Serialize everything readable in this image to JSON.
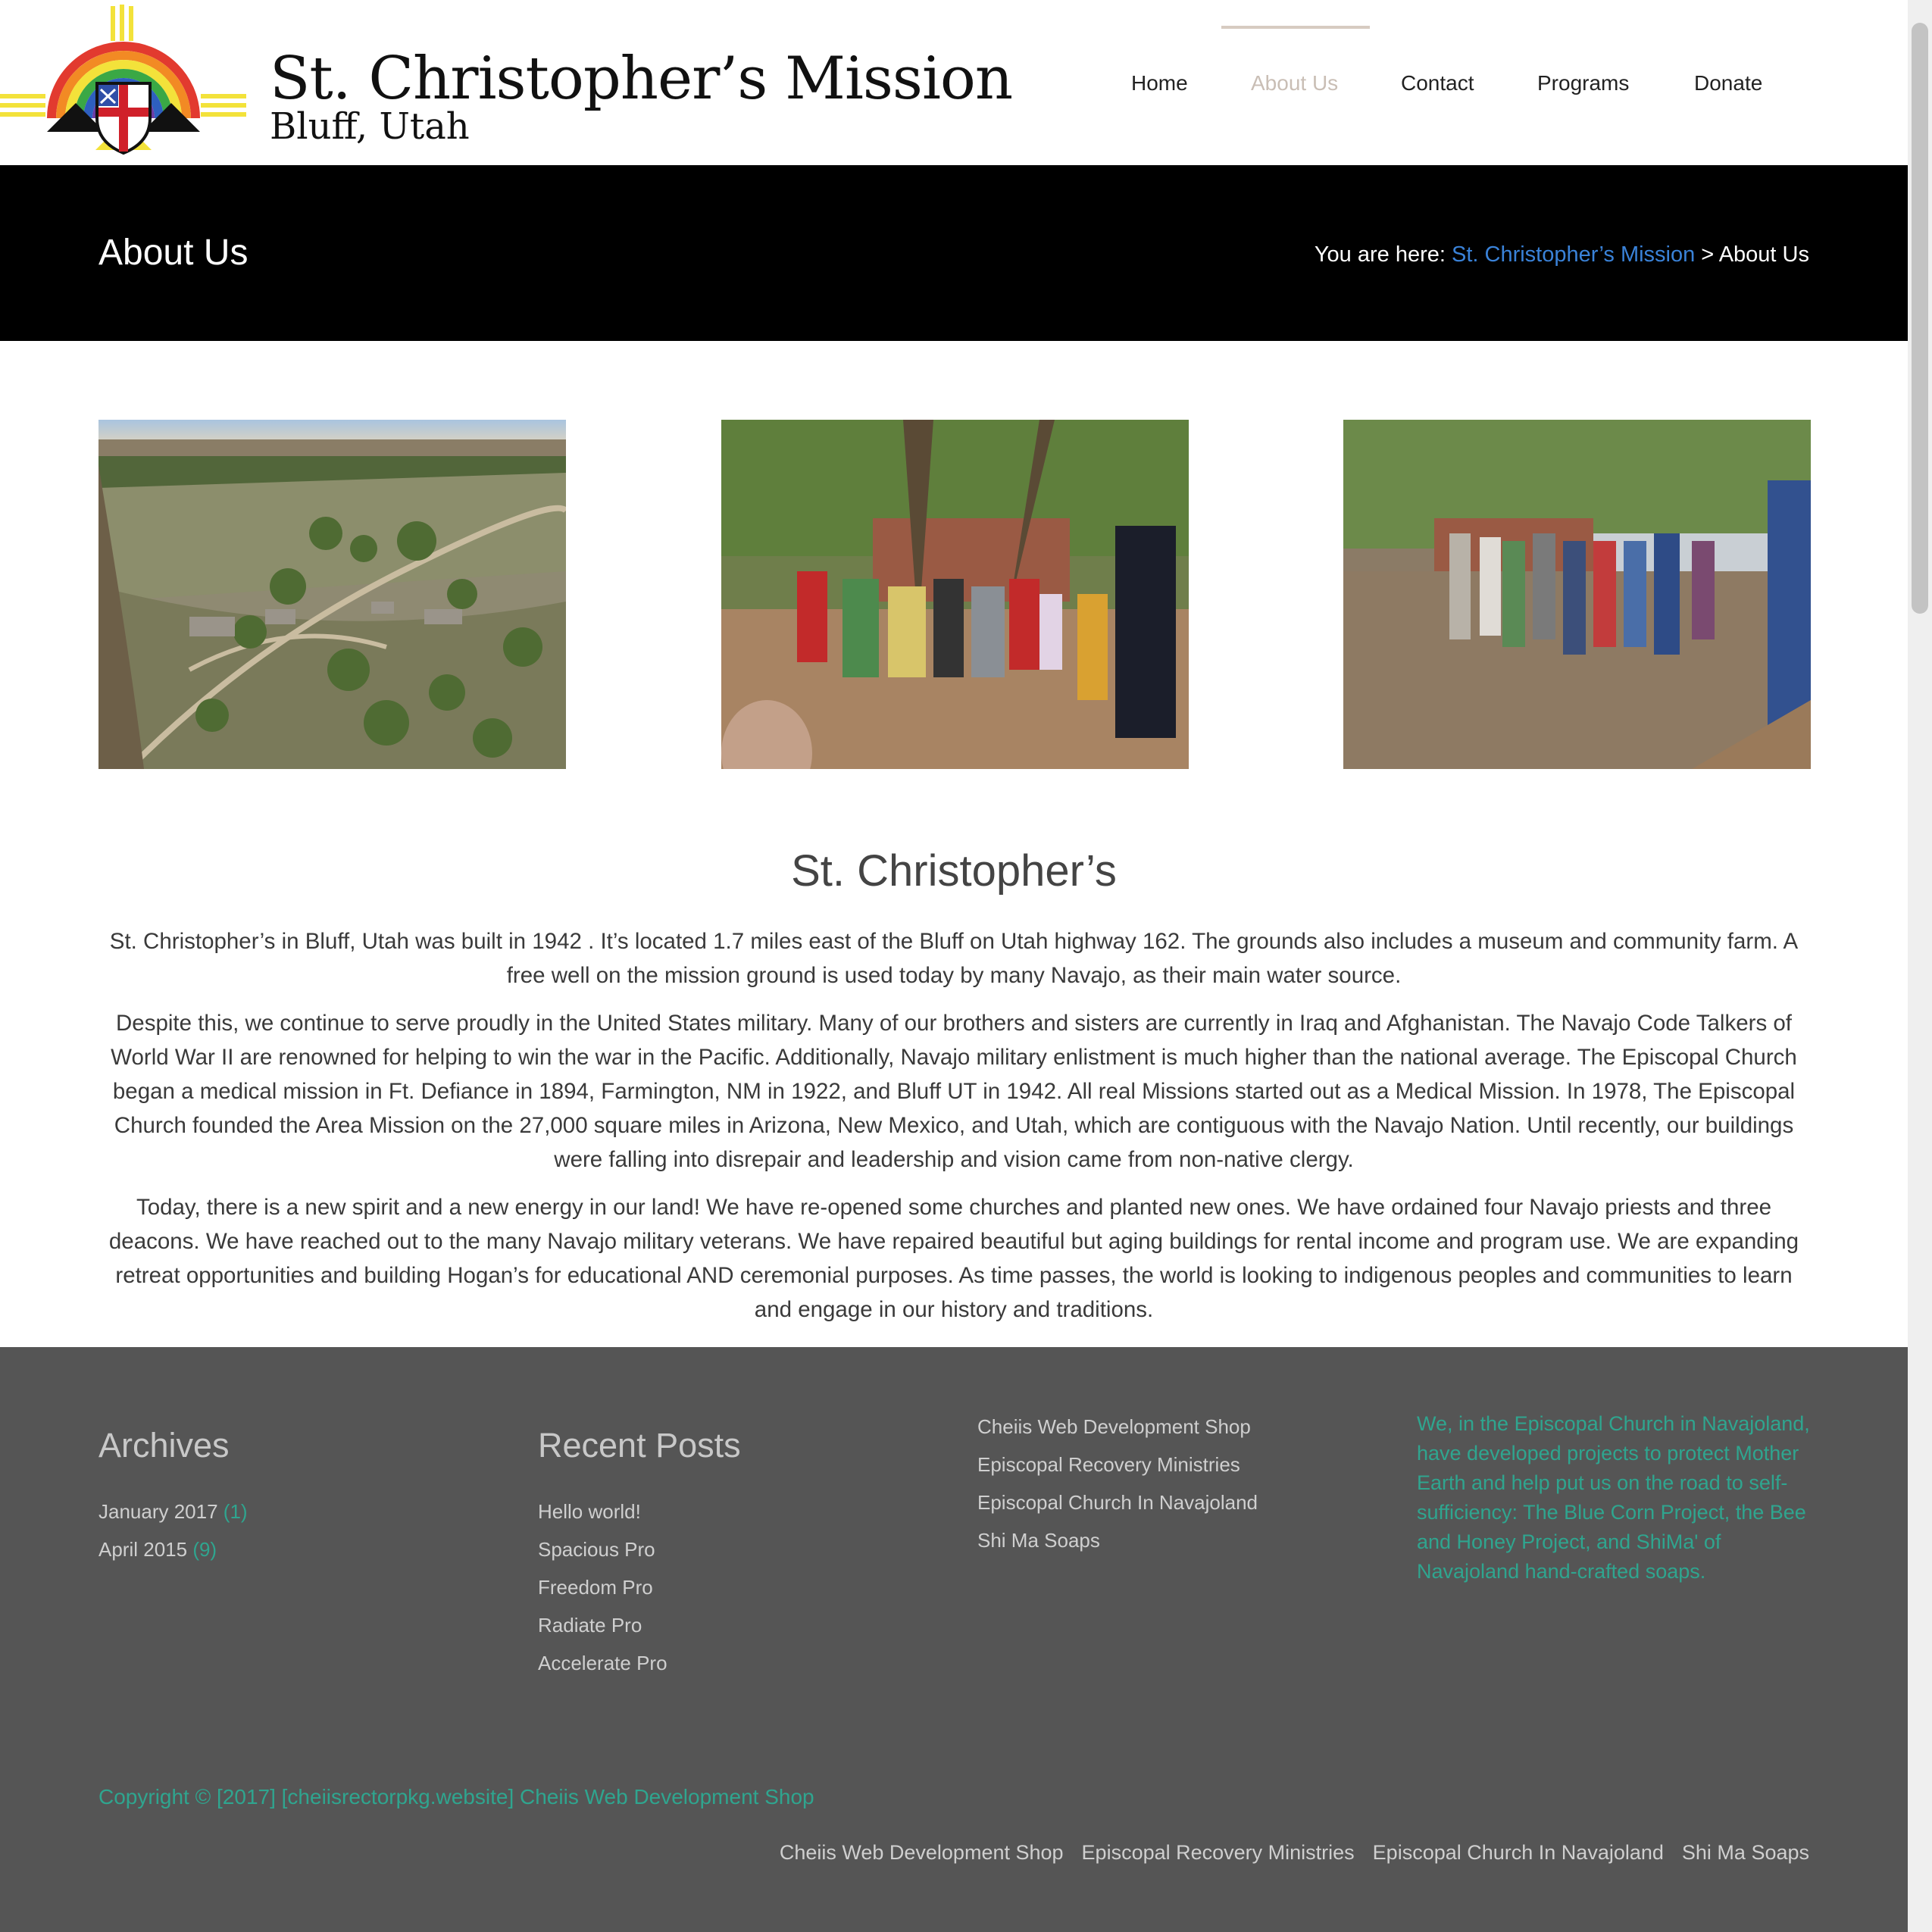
{
  "site": {
    "logo_title": "St. Christopher’s Mission",
    "logo_subtitle": "Bluff, Utah",
    "colors": {
      "accent_link": "#3a82d8",
      "footer_accent": "#2fa58f",
      "footer_bg": "#555555",
      "titlebar_bg": "#000000"
    }
  },
  "nav": {
    "items": [
      {
        "label": "Home",
        "active": false
      },
      {
        "label": "About Us",
        "active": true
      },
      {
        "label": "Contact",
        "active": false
      },
      {
        "label": "Programs",
        "active": false
      },
      {
        "label": "Donate",
        "active": false
      }
    ]
  },
  "titlebar": {
    "title": "About Us",
    "breadcrumb_prefix": "You are here: ",
    "breadcrumb_link": "St. Christopher’s Mission",
    "breadcrumb_sep": " > ",
    "breadcrumb_current": "About Us"
  },
  "content": {
    "heading": "St. Christopher’s",
    "paragraphs": [
      "St. Christopher’s in Bluff, Utah was built in 1942 . It’s located 1.7 miles east of the Bluff on Utah highway 162. The grounds also includes a museum and community farm. A free well on the mission ground is used today by many Navajo, as their main water source.",
      "Despite this, we continue to serve proudly in the United States military. Many of our brothers and sisters are currently in Iraq and Afghanistan. The Navajo Code Talkers of World War II are renowned for helping to win the war in the Pacific. Additionally, Navajo military enlistment is much higher than the national average. The Episcopal Church began a medical mission in Ft. Defiance in 1894, Farmington, NM in 1922, and Bluff UT in 1942. All real Missions started out as a Medical Mission. In 1978, The Episcopal Church founded the Area Mission on the 27,000 square miles in Arizona, New Mexico, and Utah, which are contiguous with the Navajo Nation. Until recently, our buildings were falling into disrepair and leadership and vision came from non-native clergy.",
      "Today, there is a new spirit and a new energy in our land! We have re-opened some churches and planted new ones. We have ordained four Navajo priests and three deacons. We have reached out to the many Navajo military veterans. We have repaired beautiful but aging buildings for rental income and program use. We are expanding retreat opportunities and building Hogan’s for educational AND ceremonial purposes. As time passes, the world is looking to indigenous peoples and communities to learn and engage in our history and traditions."
    ]
  },
  "footer": {
    "archives": {
      "heading": "Archives",
      "items": [
        {
          "label": "January 2017",
          "count": "(1)"
        },
        {
          "label": "April 2015",
          "count": "(9)"
        }
      ]
    },
    "recent_posts": {
      "heading": "Recent Posts",
      "items": [
        "Hello world!",
        "Spacious Pro",
        "Freedom Pro",
        "Radiate Pro",
        "Accelerate Pro"
      ]
    },
    "links": [
      "Cheiis Web Development Shop",
      "Episcopal Recovery Ministries",
      "Episcopal Church In Navajoland",
      "Shi Ma Soaps"
    ],
    "blurb": "We, in the Episcopal Church in Navajoland, have developed projects to protect Mother Earth and help put us on the road to self-sufficiency: The Blue Corn Project, the Bee and Honey Project, and ShiMa' of Navajoland hand-crafted soaps.",
    "copyright": "Copyright © [2017] [cheiisrectorpkg.website]  Cheiis Web Development Shop",
    "bottom_links": [
      "Cheiis Web Development Shop",
      "Episcopal Recovery Ministries",
      "Episcopal Church In Navajoland",
      "Shi Ma Soaps"
    ]
  }
}
